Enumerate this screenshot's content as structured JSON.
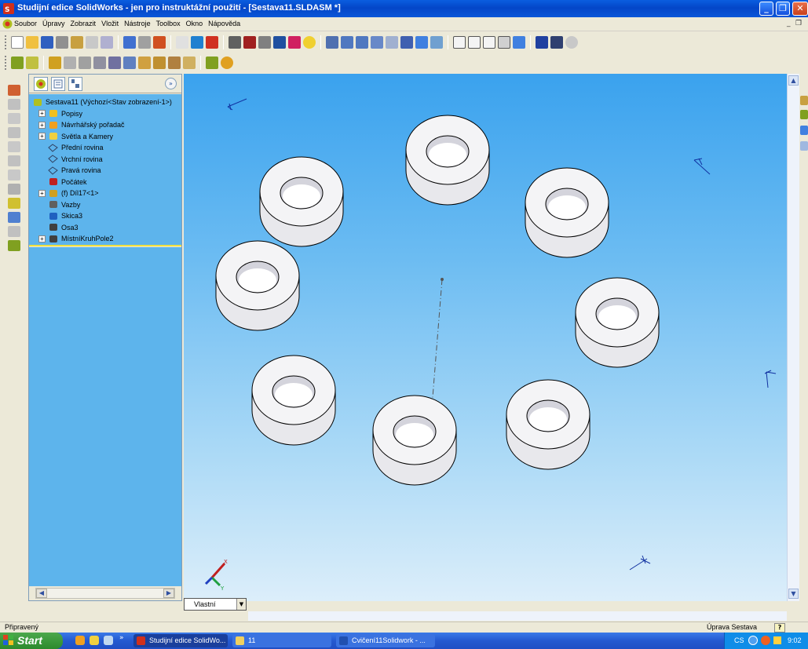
{
  "window": {
    "title": "Studijní edice SolidWorks - jen pro instruktážní použití - [Sestava11.SLDASM *]"
  },
  "menu": {
    "items": [
      "Soubor",
      "Úpravy",
      "Zobrazit",
      "Vložit",
      "Nástroje",
      "Toolbox",
      "Okno",
      "Nápověda"
    ]
  },
  "featuremanager": {
    "expand_label": "»",
    "tree": [
      {
        "label": "Sestava11  (Výchozí<Stav zobrazení-1>)",
        "icon": "assembly-icon",
        "expandable": false,
        "level": 0
      },
      {
        "label": "Popisy",
        "icon": "annotations-icon",
        "expandable": true,
        "level": 1
      },
      {
        "label": "Návrhářský pořadač",
        "icon": "design-binder-icon",
        "expandable": true,
        "level": 1
      },
      {
        "label": "Světla a Kamery",
        "icon": "lights-cameras-icon",
        "expandable": true,
        "level": 1
      },
      {
        "label": "Přední rovina",
        "icon": "plane-icon",
        "expandable": false,
        "level": 1
      },
      {
        "label": "Vrchní rovina",
        "icon": "plane-icon",
        "expandable": false,
        "level": 1
      },
      {
        "label": "Pravá rovina",
        "icon": "plane-icon",
        "expandable": false,
        "level": 1
      },
      {
        "label": "Počátek",
        "icon": "origin-icon",
        "expandable": false,
        "level": 1
      },
      {
        "label": "(f) Díl17<1>",
        "icon": "part-icon",
        "expandable": true,
        "level": 1
      },
      {
        "label": "Vazby",
        "icon": "mates-icon",
        "expandable": false,
        "level": 1
      },
      {
        "label": "Skica3",
        "icon": "sketch-icon",
        "expandable": false,
        "level": 1
      },
      {
        "label": "Osa3",
        "icon": "axis-icon",
        "expandable": false,
        "level": 1
      },
      {
        "label": "MístníKruhPole2",
        "icon": "circular-pattern-icon",
        "expandable": true,
        "level": 1
      }
    ]
  },
  "graphics": {
    "triad_x": "X",
    "triad_y": "Y",
    "rings_count": 8
  },
  "bottom_tab": {
    "label": "Vlastní"
  },
  "statusbar": {
    "left": "Připravený",
    "mode": "Úprava Sestava",
    "help": "?"
  },
  "taskbar": {
    "start": "Start",
    "tasks": [
      {
        "label": "Studijní edice SolidWo..."
      },
      {
        "label": "11"
      },
      {
        "label": "Cvičení11Solidwork - ..."
      }
    ],
    "language": "CS",
    "clock": "9:02",
    "chevron": "»"
  },
  "colors": {
    "titlebar": "#0a5ee0",
    "tree_bg": "#5db4ec",
    "viewport_top": "#3aa2ee",
    "viewport_bottom": "#dceefa"
  }
}
